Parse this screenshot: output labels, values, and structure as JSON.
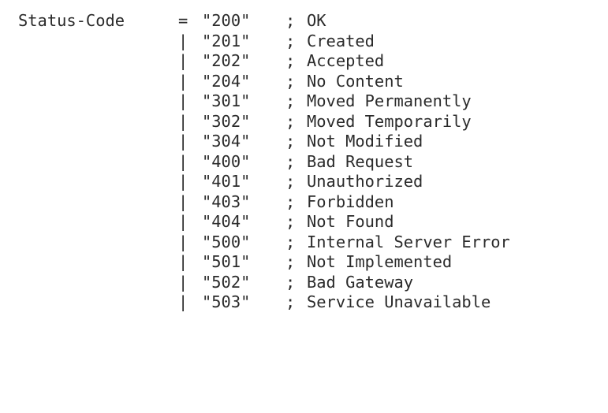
{
  "rule": {
    "name": "Status-Code",
    "definition_operator": "=",
    "alternation_operator": "|",
    "comment_marker": ";"
  },
  "entries": [
    {
      "code": "\"200\"",
      "reason": "OK"
    },
    {
      "code": "\"201\"",
      "reason": "Created"
    },
    {
      "code": "\"202\"",
      "reason": "Accepted"
    },
    {
      "code": "\"204\"",
      "reason": "No Content"
    },
    {
      "code": "\"301\"",
      "reason": "Moved Permanently"
    },
    {
      "code": "\"302\"",
      "reason": "Moved Temporarily"
    },
    {
      "code": "\"304\"",
      "reason": "Not Modified"
    },
    {
      "code": "\"400\"",
      "reason": "Bad Request"
    },
    {
      "code": "\"401\"",
      "reason": "Unauthorized"
    },
    {
      "code": "\"403\"",
      "reason": "Forbidden"
    },
    {
      "code": "\"404\"",
      "reason": "Not Found"
    },
    {
      "code": "\"500\"",
      "reason": "Internal Server Error"
    },
    {
      "code": "\"501\"",
      "reason": "Not Implemented"
    },
    {
      "code": "\"502\"",
      "reason": "Bad Gateway"
    },
    {
      "code": "\"503\"",
      "reason": "Service Unavailable"
    }
  ]
}
